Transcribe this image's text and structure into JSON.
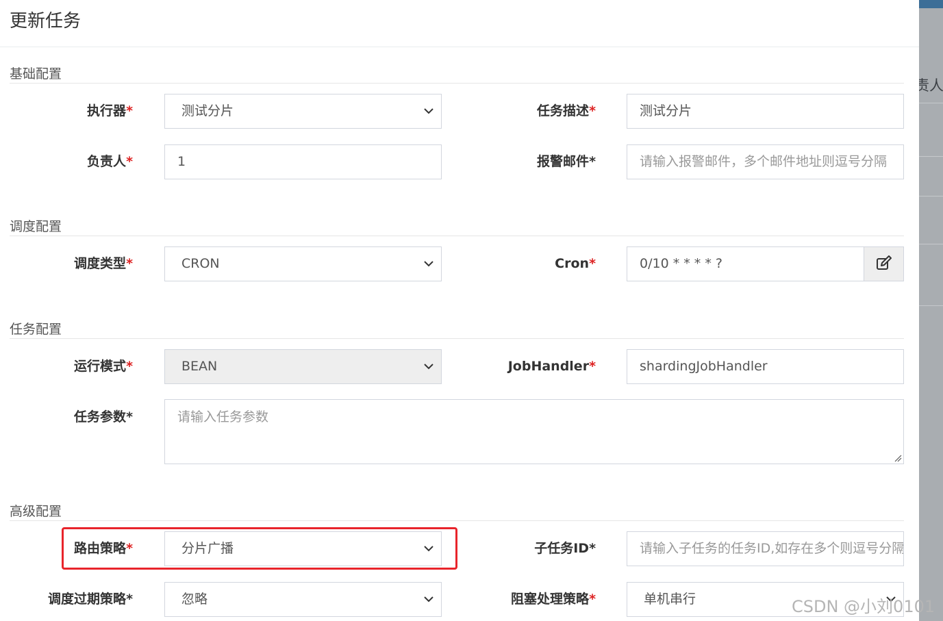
{
  "modal": {
    "title": "更新任务"
  },
  "backdrop": {
    "partial_text": "责人"
  },
  "sections": {
    "basic": "基础配置",
    "schedule": "调度配置",
    "task": "任务配置",
    "advanced": "高级配置"
  },
  "fields": {
    "executor": {
      "label": "执行器",
      "req": "*",
      "value": "测试分片"
    },
    "job_desc": {
      "label": "任务描述",
      "req": "*",
      "value": "测试分片"
    },
    "author": {
      "label": "负责人",
      "req": "*",
      "value": "1"
    },
    "alarm_email": {
      "label": "报警邮件",
      "req": "*",
      "placeholder": "请输入报警邮件，多个邮件地址则逗号分隔"
    },
    "schedule_type": {
      "label": "调度类型",
      "req": "*",
      "value": "CRON"
    },
    "cron": {
      "label": "Cron",
      "req": "*",
      "value": "0/10 * * * * ?"
    },
    "glue_type": {
      "label": "运行模式",
      "req": "*",
      "value": "BEAN"
    },
    "job_handler": {
      "label": "JobHandler",
      "req": "*",
      "value": "shardingJobHandler"
    },
    "job_param": {
      "label": "任务参数",
      "req": "*",
      "placeholder": "请输入任务参数"
    },
    "route_strategy": {
      "label": "路由策略",
      "req": "*",
      "value": "分片广播"
    },
    "child_job_id": {
      "label": "子任务ID",
      "req": "*",
      "placeholder": "请输入子任务的任务ID,如存在多个则逗号分隔"
    },
    "misfire_strategy": {
      "label": "调度过期策略",
      "req": "*",
      "value": "忽略"
    },
    "block_strategy": {
      "label": "阻塞处理策略",
      "req": "*",
      "value": "单机串行"
    }
  },
  "icons": {
    "select_caret": "chevron-down-icon",
    "cron_edit": "edit-icon"
  },
  "colors": {
    "required_star": "#dd2222",
    "highlight_box": "#e8242b"
  },
  "watermark": "CSDN @小刘0101"
}
